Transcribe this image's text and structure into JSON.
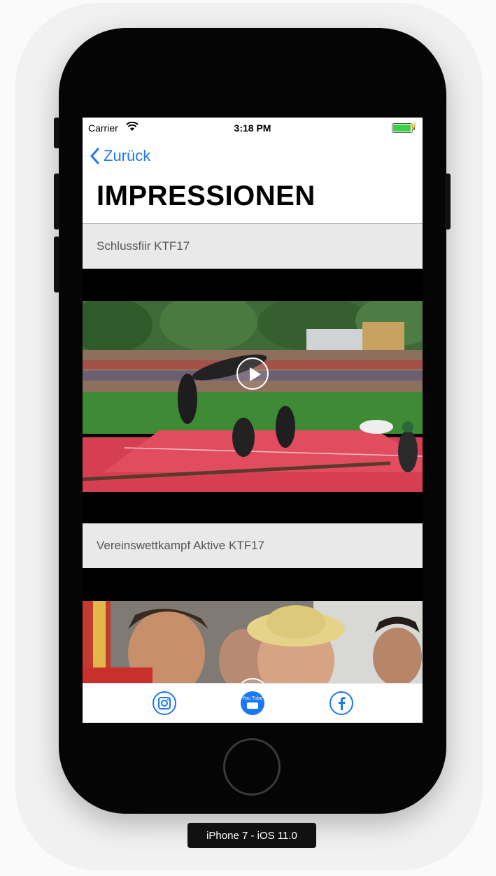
{
  "status_bar": {
    "carrier": "Carrier",
    "time": "3:18 PM"
  },
  "nav": {
    "back_label": "Zurück",
    "title": "IMPRESSIONEN"
  },
  "videos": [
    {
      "title": "Schlussfiir KTF17"
    },
    {
      "title": "Vereinswettkampf Aktive KTF17"
    }
  ],
  "tabbar": {
    "items": [
      {
        "icon": "instagram-icon"
      },
      {
        "icon": "youtube-icon",
        "selected": true,
        "label": "You Tube"
      },
      {
        "icon": "facebook-icon"
      }
    ]
  },
  "device": {
    "label": "iPhone 7 - iOS 11.0"
  },
  "colors": {
    "accent": "#1c77f2",
    "section_bg": "#e9e9e9"
  }
}
